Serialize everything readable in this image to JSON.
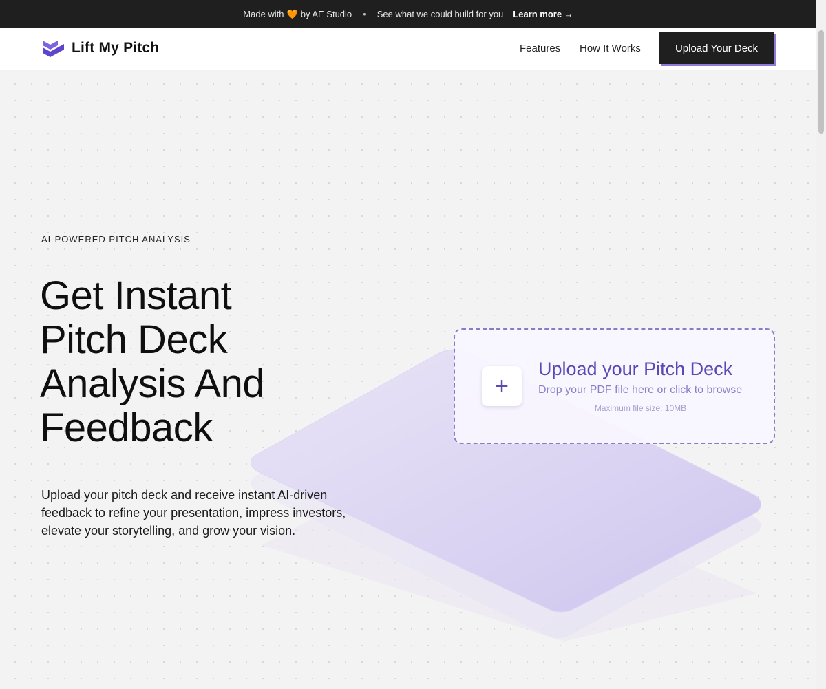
{
  "topbar": {
    "made_with": "Made with",
    "heart": "🧡",
    "by": "by AE Studio",
    "separator": "•",
    "tagline": "See what we could build for you",
    "learn_more": "Learn more →"
  },
  "navbar": {
    "logo_text": "Lift My Pitch",
    "links": [
      "Features",
      "How It Works"
    ],
    "cta": "Upload Your Deck"
  },
  "hero": {
    "eyebrow": "AI-POWERED PITCH ANALYSIS",
    "headline_lines": [
      "Get Instant",
      "Pitch Deck",
      "Analysis And",
      "Feedback"
    ],
    "subtext": "Upload your pitch deck and receive instant AI-driven feedback to refine your presentation, impress investors, elevate your storytelling, and grow your vision."
  },
  "dropzone": {
    "plus": "+",
    "title": "Upload your Pitch Deck",
    "subtitle": "Drop your PDF file here or click to browse",
    "max_size": "Maximum file size: 10MB"
  },
  "colors": {
    "accent": "#8f7ad8",
    "dark": "#1f1f1f",
    "dropzone_title": "#5a48b5"
  },
  "icons": {
    "logo": "stacked-chevron-logo-icon",
    "upload": "plus-icon"
  }
}
